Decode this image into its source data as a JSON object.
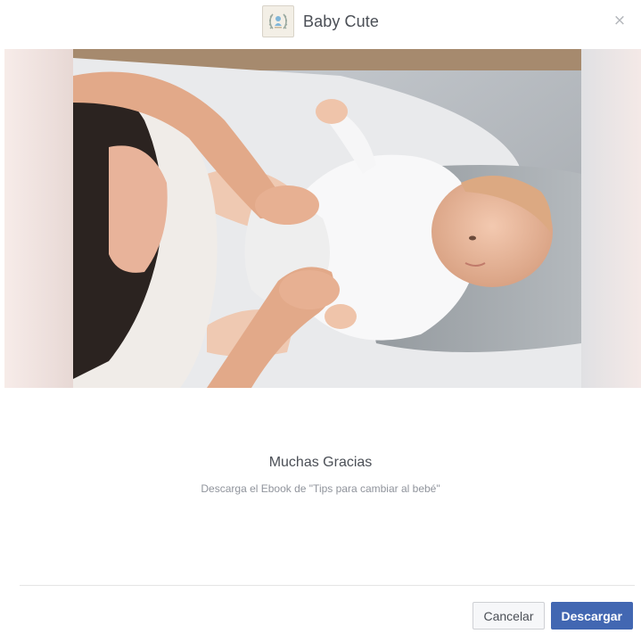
{
  "header": {
    "brand_name": "Baby Cute",
    "close_glyph": "×",
    "icons": {
      "logo": "baby-laurel-logo-icon",
      "close": "close-icon"
    }
  },
  "hero": {
    "image_subject": "hero-photo"
  },
  "content": {
    "title": "Muchas Gracias",
    "subtitle": "Descarga el Ebook de \"Tips para cambiar al bebé\""
  },
  "footer": {
    "cancel_label": "Cancelar",
    "primary_label": "Descargar"
  },
  "colors": {
    "primary": "#4267b2",
    "text_dark": "#4b4f56",
    "text_muted": "#90949c",
    "divider": "#e5e5e5"
  }
}
